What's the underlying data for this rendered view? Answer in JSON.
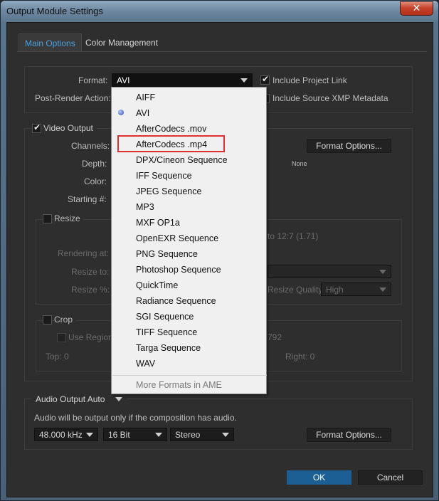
{
  "window": {
    "title": "Output Module Settings",
    "close_glyph": "✕"
  },
  "tabs": [
    {
      "label": "Main Options"
    },
    {
      "label": "Color Management"
    }
  ],
  "format": {
    "label": "Format:",
    "value": "AVI",
    "include_project_link": "Include Project Link",
    "post_render_label": "Post-Render Action:",
    "include_xmp": "Include Source XMP Metadata"
  },
  "video": {
    "label": "Video Output",
    "channels": "Channels:",
    "depth": "Depth:",
    "color": "Color:",
    "starting": "Starting #:",
    "format_options": "Format Options...",
    "none_text": "None"
  },
  "resize": {
    "label": "Resize",
    "rendering_at": "Rendering at:",
    "resize_to": "Resize to:",
    "resize_pct": "Resize %:",
    "ratio_text": "to 12:7 (1.71)",
    "quality_label": "Resize Quality:",
    "quality_value": "High"
  },
  "crop": {
    "label": "Crop",
    "use_region": "Use Region",
    "size_text": "792",
    "top": "Top:  0",
    "right": "Right:  0"
  },
  "menu": {
    "items": [
      "AIFF",
      "AVI",
      "AfterCodecs .mov",
      "AfterCodecs .mp4",
      "DPX/Cineon Sequence",
      "IFF Sequence",
      "JPEG Sequence",
      "MP3",
      "MXF OP1a",
      "OpenEXR Sequence",
      "PNG Sequence",
      "Photoshop Sequence",
      "QuickTime",
      "Radiance Sequence",
      "SGI Sequence",
      "TIFF Sequence",
      "Targa Sequence",
      "WAV"
    ],
    "more": "More Formats in AME",
    "selected": "AVI",
    "highlighted": "AfterCodecs .mp4"
  },
  "audio": {
    "mode": "Audio Output Auto",
    "note": "Audio will be output only if the composition has audio.",
    "rate": "48.000 kHz",
    "bits": "16 Bit",
    "channels": "Stereo",
    "format_options": "Format Options..."
  },
  "footer": {
    "ok": "OK",
    "cancel": "Cancel"
  },
  "colors": {
    "accent": "#4aa0e0",
    "ok_button": "#1b5f94",
    "highlight_box": "#e03030"
  }
}
